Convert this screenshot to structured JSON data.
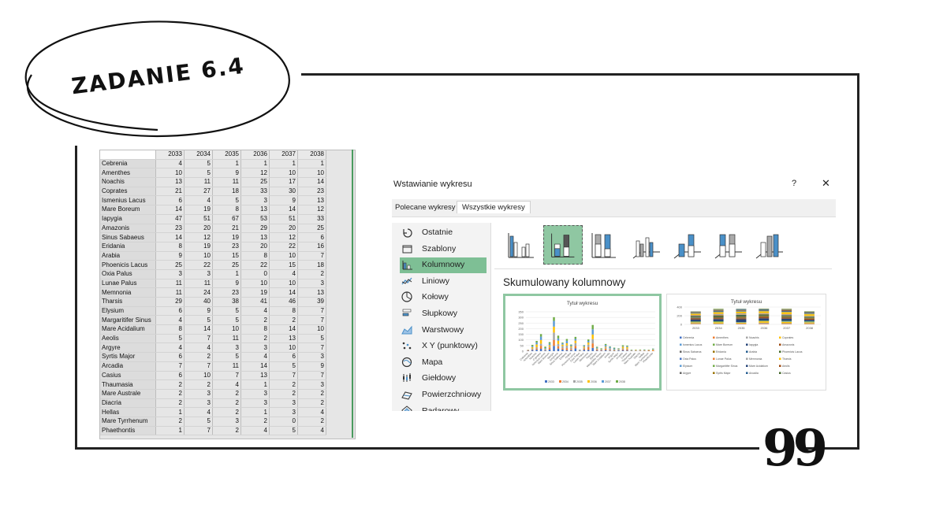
{
  "title": "ZADANIE 6.4",
  "quote_mark": "99",
  "sheet": {
    "years": [
      "2033",
      "2034",
      "2035",
      "2036",
      "2037",
      "2038"
    ],
    "rows": [
      {
        "name": "Cebrenia",
        "v": [
          4,
          5,
          1,
          1,
          1,
          1
        ]
      },
      {
        "name": "Amenthes",
        "v": [
          10,
          5,
          9,
          12,
          10,
          10
        ]
      },
      {
        "name": "Noachis",
        "v": [
          13,
          11,
          11,
          25,
          17,
          14
        ]
      },
      {
        "name": "Coprates",
        "v": [
          21,
          27,
          18,
          33,
          30,
          23
        ]
      },
      {
        "name": "Ismenius Lacus",
        "v": [
          6,
          4,
          5,
          3,
          9,
          13
        ]
      },
      {
        "name": "Mare Boreum",
        "v": [
          14,
          19,
          8,
          13,
          14,
          12
        ]
      },
      {
        "name": "Iapygia",
        "v": [
          47,
          51,
          67,
          53,
          51,
          33
        ]
      },
      {
        "name": "Amazonis",
        "v": [
          23,
          20,
          21,
          29,
          20,
          25
        ]
      },
      {
        "name": "Sinus Sabaeus",
        "v": [
          14,
          12,
          19,
          13,
          12,
          6
        ]
      },
      {
        "name": "Eridania",
        "v": [
          8,
          19,
          23,
          20,
          22,
          16
        ]
      },
      {
        "name": "Arabia",
        "v": [
          9,
          10,
          15,
          8,
          10,
          7
        ]
      },
      {
        "name": "Phoenicis Lacus",
        "v": [
          25,
          22,
          25,
          22,
          15,
          18
        ]
      },
      {
        "name": "Oxia Palus",
        "v": [
          3,
          3,
          1,
          0,
          4,
          2
        ]
      },
      {
        "name": "Lunae Palus",
        "v": [
          11,
          11,
          9,
          10,
          10,
          3
        ]
      },
      {
        "name": "Memnonia",
        "v": [
          11,
          24,
          23,
          19,
          14,
          13
        ]
      },
      {
        "name": "Tharsis",
        "v": [
          29,
          40,
          38,
          41,
          46,
          39
        ]
      },
      {
        "name": "Elysium",
        "v": [
          6,
          9,
          5,
          4,
          8,
          7
        ]
      },
      {
        "name": "Margaritifer Sinus",
        "v": [
          4,
          5,
          5,
          2,
          2,
          7
        ]
      },
      {
        "name": "Mare Acidalium",
        "v": [
          8,
          14,
          10,
          8,
          14,
          10
        ]
      },
      {
        "name": "Aeolis",
        "v": [
          5,
          7,
          11,
          2,
          13,
          5
        ]
      },
      {
        "name": "Argyre",
        "v": [
          4,
          4,
          3,
          3,
          10,
          7
        ]
      },
      {
        "name": "Syrtis Major",
        "v": [
          6,
          2,
          5,
          4,
          6,
          3
        ]
      },
      {
        "name": "Arcadia",
        "v": [
          7,
          7,
          11,
          14,
          5,
          9
        ]
      },
      {
        "name": "Casius",
        "v": [
          6,
          10,
          7,
          13,
          7,
          7
        ]
      },
      {
        "name": "Thaumasia",
        "v": [
          2,
          2,
          4,
          1,
          2,
          3
        ]
      },
      {
        "name": "Mare Australe",
        "v": [
          2,
          3,
          2,
          3,
          2,
          2
        ]
      },
      {
        "name": "Diacria",
        "v": [
          2,
          3,
          2,
          3,
          3,
          2
        ]
      },
      {
        "name": "Hellas",
        "v": [
          1,
          4,
          2,
          1,
          3,
          4
        ]
      },
      {
        "name": "Mare Tyrrhenum",
        "v": [
          2,
          5,
          3,
          2,
          0,
          2
        ]
      },
      {
        "name": "Phaethontis",
        "v": [
          1,
          7,
          2,
          4,
          5,
          4
        ]
      }
    ]
  },
  "dialog": {
    "title": "Wstawianie wykresu",
    "help": "?",
    "close": "✕",
    "tabs": [
      "Polecane wykresy",
      "Wszystkie wykresy"
    ],
    "categories": [
      {
        "label": "Ostatnie",
        "icon": "recent-icon"
      },
      {
        "label": "Szablony",
        "icon": "templates-icon"
      },
      {
        "label": "Kolumnowy",
        "icon": "column-chart-icon",
        "selected": true
      },
      {
        "label": "Liniowy",
        "icon": "line-chart-icon"
      },
      {
        "label": "Kołowy",
        "icon": "pie-chart-icon"
      },
      {
        "label": "Słupkowy",
        "icon": "bar-chart-icon"
      },
      {
        "label": "Warstwowy",
        "icon": "area-chart-icon"
      },
      {
        "label": "X Y (punktowy)",
        "icon": "scatter-chart-icon"
      },
      {
        "label": "Mapa",
        "icon": "map-chart-icon"
      },
      {
        "label": "Giełdowy",
        "icon": "stock-chart-icon"
      },
      {
        "label": "Powierzchniowy",
        "icon": "surface-chart-icon"
      },
      {
        "label": "Radarowy",
        "icon": "radar-chart-icon"
      }
    ],
    "chart_name": "Skumulowany kolumnowy",
    "preview_title": "Tytuł wykresu",
    "preview1_yticks": [
      "350",
      "300",
      "250",
      "200",
      "150",
      "100",
      "50",
      "0"
    ],
    "preview1_legend": [
      "2033",
      "2034",
      "2035",
      "2036",
      "2037",
      "2038"
    ],
    "preview2_yticks": [
      "400",
      "200",
      "0"
    ],
    "preview2_xcats": [
      "2033",
      "2034",
      "2035",
      "2036",
      "2037",
      "2038"
    ],
    "preview2_legend": [
      "Cebrenia",
      "Amenthes",
      "Noachis",
      "Coprates",
      "Ismenius Lacus",
      "Mare Boreum",
      "Iapygia",
      "Amazonis",
      "Sinus Sabaeus",
      "Eridania",
      "Arabia",
      "Phoenicis Lacus",
      "Oxia Palus",
      "Lunae Palus",
      "Memnonia",
      "Tharsis",
      "Elysium",
      "Margaritifer Sinus",
      "Mare Acidalium",
      "Aeolis",
      "Argyre",
      "Syrtis Major",
      "Arcadia",
      "Casius"
    ]
  },
  "colors": {
    "accent": "#8fc7a2",
    "frame": "#222222",
    "blue": "#4472c4",
    "orange": "#ed7d31",
    "gray": "#a5a5a5",
    "yellow": "#ffc000",
    "lightblue": "#5b9bd5",
    "green": "#70ad47"
  }
}
